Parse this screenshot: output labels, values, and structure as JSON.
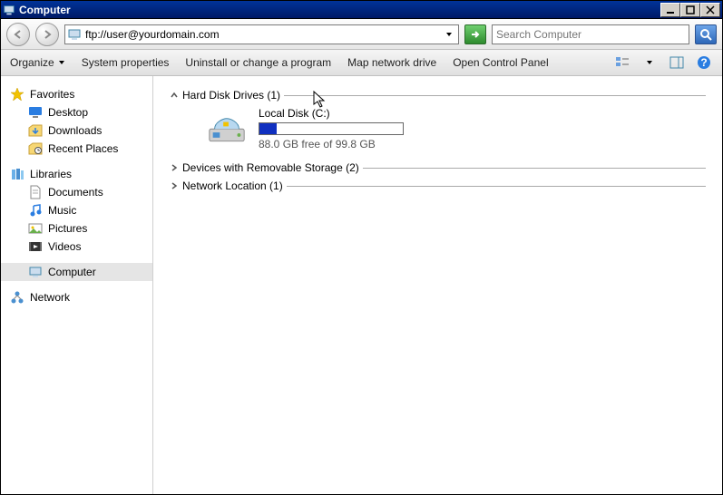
{
  "window": {
    "title": "Computer"
  },
  "nav": {
    "address": "ftp://user@yourdomain.com",
    "search_placeholder": "Search Computer"
  },
  "toolbar": {
    "organize": "Organize",
    "system_properties": "System properties",
    "uninstall": "Uninstall or change a program",
    "map_drive": "Map network drive",
    "control_panel": "Open Control Panel"
  },
  "sidebar": {
    "favorites": {
      "label": "Favorites",
      "items": [
        "Desktop",
        "Downloads",
        "Recent Places"
      ]
    },
    "libraries": {
      "label": "Libraries",
      "items": [
        "Documents",
        "Music",
        "Pictures",
        "Videos"
      ]
    },
    "computer": {
      "label": "Computer"
    },
    "network": {
      "label": "Network"
    }
  },
  "sections": {
    "hdd": {
      "label": "Hard Disk Drives (1)"
    },
    "removable": {
      "label": "Devices with Removable Storage (2)"
    },
    "netloc": {
      "label": "Network Location (1)"
    }
  },
  "drive": {
    "name": "Local Disk (C:)",
    "free": "88.0 GB free of 99.8 GB",
    "used_percent": 12
  }
}
